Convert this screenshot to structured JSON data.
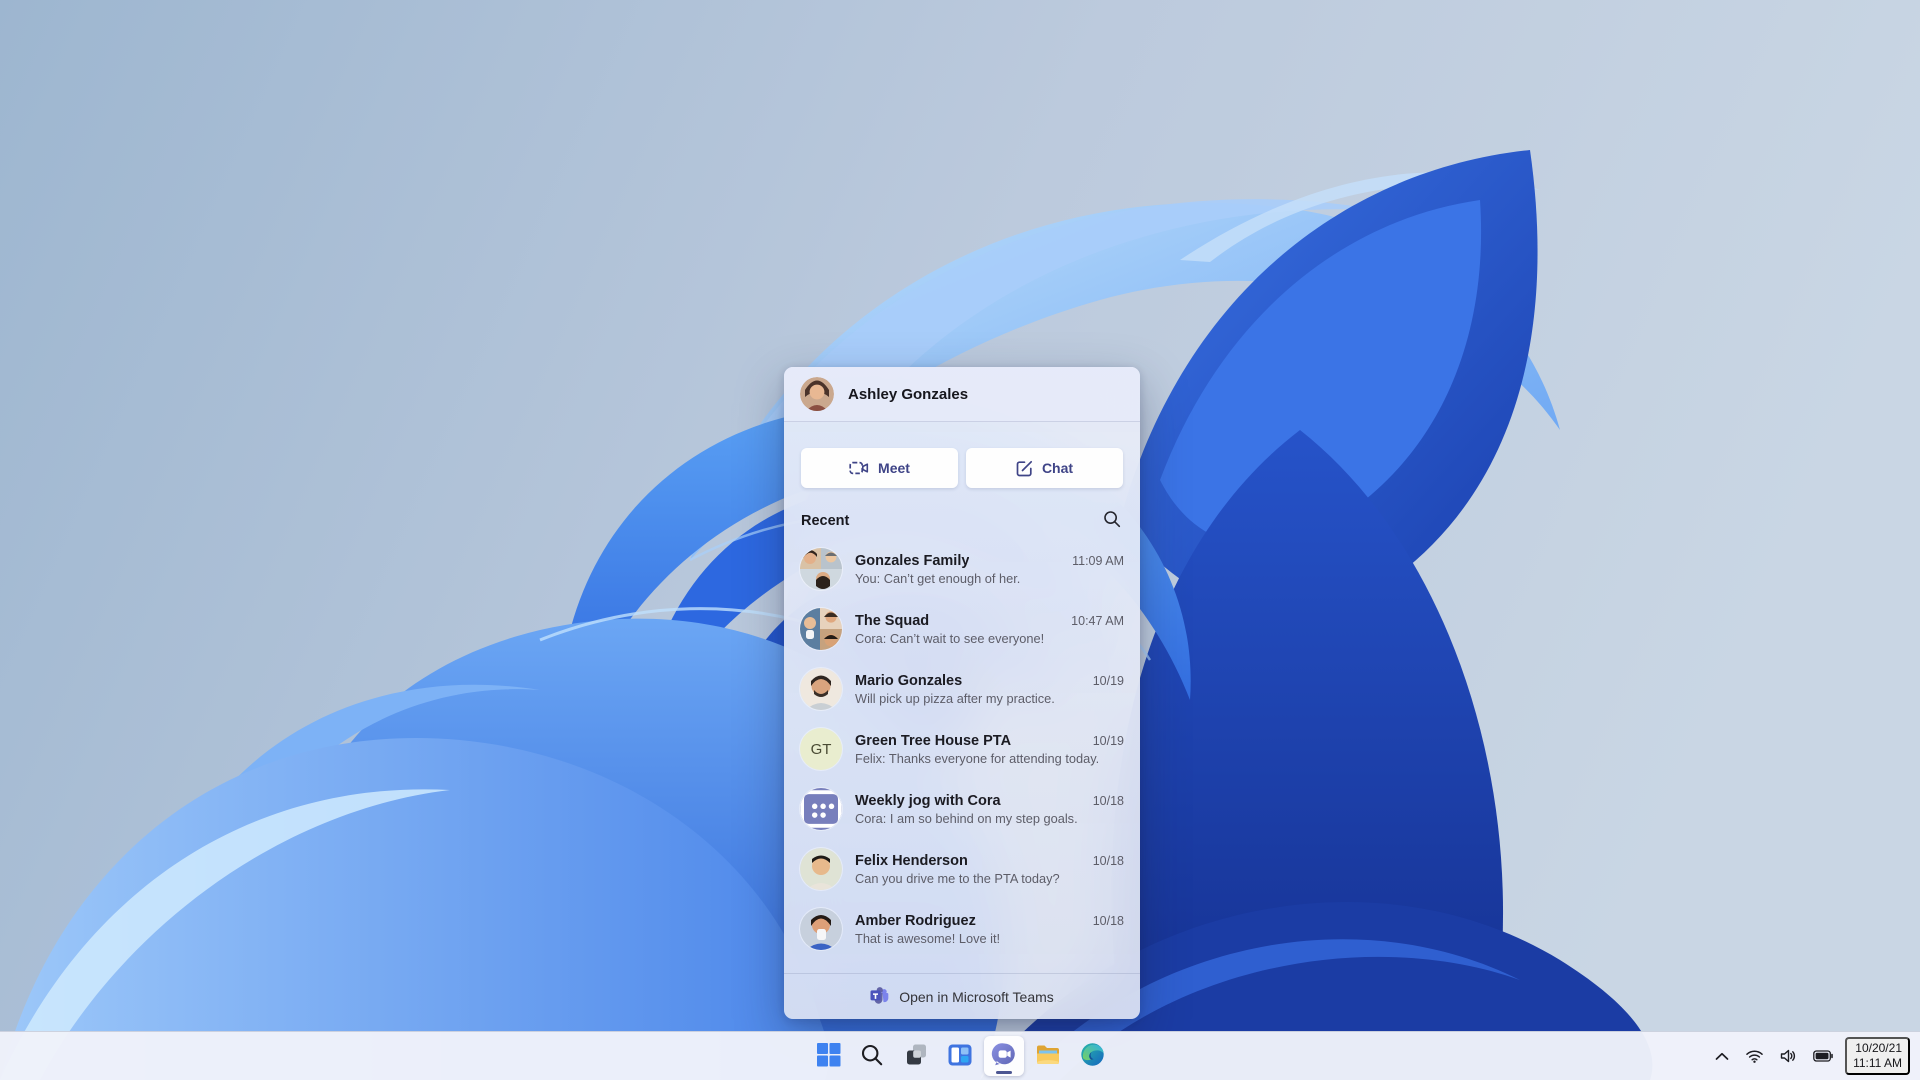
{
  "theme": {
    "teams_purple": "#3f4487",
    "teams_bubble": "#7b83d6",
    "taskbar_bg": "#f0f2fa",
    "panel_bg": "#e6eaf6",
    "accent_blue": "#2b63dc",
    "text_primary": "#1b1b22",
    "text_secondary": "#5d5d68"
  },
  "flyout": {
    "header": {
      "name": "Ashley Gonzales",
      "avatar_icon": "ashley-avatar"
    },
    "buttons": {
      "meet_label": "Meet",
      "meet_icon": "video-camera-icon",
      "chat_label": "Chat",
      "chat_icon": "compose-icon"
    },
    "recent_label": "Recent",
    "search_icon": "search-icon",
    "items": [
      {
        "title": "Gonzales Family",
        "preview": "You: Can’t get enough of her.",
        "time": "11:09 AM",
        "avatar": "group-collage"
      },
      {
        "title": "The Squad",
        "preview": "Cora: Can’t wait to see everyone!",
        "time": "10:47 AM",
        "avatar": "group-collage"
      },
      {
        "title": "Mario Gonzales",
        "preview": "Will pick up pizza after my practice.",
        "time": "10/19",
        "avatar": "photo"
      },
      {
        "title": "Green Tree House PTA",
        "preview": "Felix: Thanks everyone for attending today.",
        "time": "10/19",
        "avatar": "initials",
        "avatar_text": "GT"
      },
      {
        "title": "Weekly jog with Cora",
        "preview": "Cora: I am so behind on my step goals.",
        "time": "10/18",
        "avatar": "calendar-icon"
      },
      {
        "title": "Felix Henderson",
        "preview": "Can you drive me to the PTA today?",
        "time": "10/18",
        "avatar": "photo"
      },
      {
        "title": "Amber Rodriguez",
        "preview": "That is awesome! Love it!",
        "time": "10/18",
        "avatar": "photo"
      }
    ],
    "footer": {
      "label": "Open in Microsoft Teams",
      "icon": "teams-logo-icon"
    }
  },
  "taskbar": {
    "buttons": [
      {
        "name": "Start",
        "icon": "windows-start-icon"
      },
      {
        "name": "Search",
        "icon": "search-icon"
      },
      {
        "name": "Task view",
        "icon": "task-view-icon"
      },
      {
        "name": "Widgets",
        "icon": "widgets-icon"
      },
      {
        "name": "Chat",
        "icon": "teams-chat-icon",
        "active": true
      },
      {
        "name": "File Explorer",
        "icon": "folder-icon"
      },
      {
        "name": "Microsoft Edge",
        "icon": "edge-icon"
      }
    ],
    "tray": {
      "icons": [
        "chevron-up-icon",
        "wifi-icon",
        "volume-icon",
        "battery-icon"
      ],
      "date": "10/20/21",
      "time": "11:11 AM"
    }
  }
}
